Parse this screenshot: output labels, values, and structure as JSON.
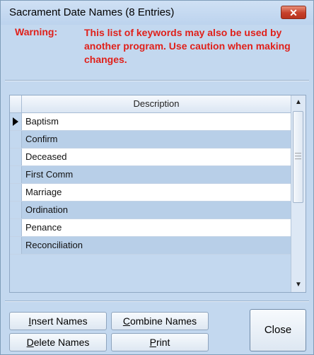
{
  "window": {
    "title": "Sacrament Date Names (8 Entries)",
    "close_glyph": "✕"
  },
  "warning": {
    "label": "Warning:",
    "text": "This list of keywords may also be used by another program. Use caution when making changes.",
    "color": "#e0201a"
  },
  "grid": {
    "column_header": "Description",
    "current_row_index": 0,
    "rows": [
      "Baptism",
      "Confirm",
      "Deceased",
      "First Comm",
      "Marriage",
      "Ordination",
      "Penance",
      "Reconciliation"
    ]
  },
  "buttons": {
    "insert": {
      "mnemonic": "I",
      "rest": "nsert Names"
    },
    "combine": {
      "mnemonic": "C",
      "rest": "ombine Names"
    },
    "delete": {
      "mnemonic": "D",
      "rest": "elete Names"
    },
    "print": {
      "mnemonic": "P",
      "rest": "rint"
    },
    "close": "Close"
  },
  "icons": {
    "current_row": "row-pointer-icon",
    "scroll_up": "scroll-up-icon",
    "scroll_down": "scroll-down-icon",
    "close": "close-icon"
  }
}
